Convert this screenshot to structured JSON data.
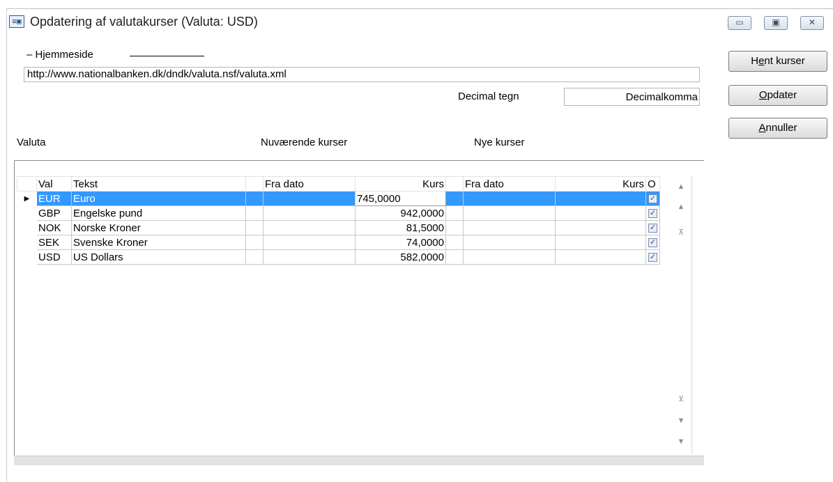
{
  "window": {
    "title": "Opdatering af valutakurser (Valuta: USD)",
    "icon": "form-icon",
    "controls": {
      "minimize": "▭",
      "restore": "▣",
      "close": "✕"
    }
  },
  "homepage": {
    "group_label": "– Hjemmeside",
    "url": "http://www.nationalbanken.dk/dndk/valuta.nsf/valuta.xml"
  },
  "decimal": {
    "label": "Decimal tegn",
    "value": "Decimalkomma"
  },
  "buttons": {
    "fetch": {
      "pre": "H",
      "accel": "e",
      "post": "nt kurser"
    },
    "update": {
      "pre": "",
      "accel": "O",
      "post": "pdater"
    },
    "cancel": {
      "pre": "",
      "accel": "A",
      "post": "nnuller"
    }
  },
  "sections": {
    "currency": "Valuta",
    "current": "Nuværende kurser",
    "new": "Nye kurser"
  },
  "grid": {
    "columns": {
      "val": "Val",
      "tekst": "Tekst",
      "fra_dato_current": "Fra dato",
      "kurs_current": "Kurs",
      "fra_dato_new": "Fra dato",
      "kurs_new": "Kurs",
      "o": "O"
    },
    "rows": [
      {
        "val": "EUR",
        "tekst": "Euro",
        "fra_dato": "",
        "kurs": "745,0000",
        "nye_fra_dato": "",
        "nye_kurs": "",
        "o": true
      },
      {
        "val": "GBP",
        "tekst": "Engelske pund",
        "fra_dato": "",
        "kurs": "942,0000",
        "nye_fra_dato": "",
        "nye_kurs": "",
        "o": true
      },
      {
        "val": "NOK",
        "tekst": "Norske Kroner",
        "fra_dato": "",
        "kurs": "81,5000",
        "nye_fra_dato": "",
        "nye_kurs": "",
        "o": true
      },
      {
        "val": "SEK",
        "tekst": "Svenske Kroner",
        "fra_dato": "",
        "kurs": "74,0000",
        "nye_fra_dato": "",
        "nye_kurs": "",
        "o": true
      },
      {
        "val": "USD",
        "tekst": "US Dollars",
        "fra_dato": "",
        "kurs": "582,0000",
        "nye_fra_dato": "",
        "nye_kurs": "",
        "o": true
      }
    ],
    "current_row_marker": "▶",
    "check_mark": "✓"
  },
  "navigation": {
    "first_page": "▲",
    "prev": "▲",
    "first": "⊼",
    "last": "⊻",
    "next": "▼",
    "last_page": "▼"
  },
  "colors": {
    "selection": "#3399ff",
    "title_text": "#1e1e1e"
  }
}
